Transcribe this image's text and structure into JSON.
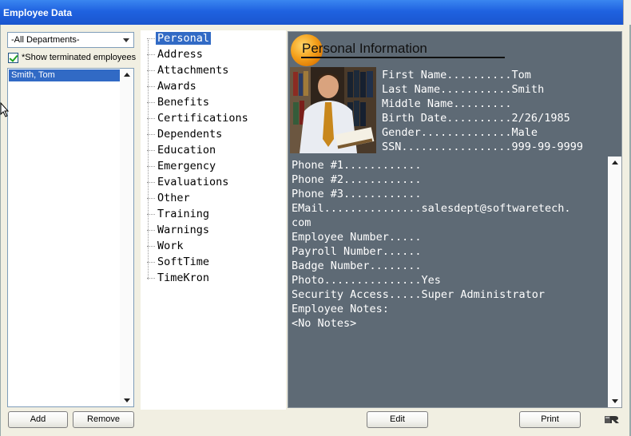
{
  "window": {
    "title": "Employee Data"
  },
  "left": {
    "department_select": "-All Departments-",
    "show_terminated_label": "*Show terminated employees",
    "show_terminated_checked": true,
    "employees": [
      "Smith, Tom"
    ]
  },
  "sections": [
    "Personal",
    "Address",
    "Attachments",
    "Awards",
    "Benefits",
    "Certifications",
    "Dependents",
    "Education",
    "Emergency",
    "Evaluations",
    "Other",
    "Training",
    "Warnings",
    "Work",
    "SoftTime",
    "TimeKron"
  ],
  "selected_section": "Personal",
  "detail": {
    "header": "Personal Information",
    "top_fields": [
      "First Name..........Tom",
      "Last Name...........Smith",
      "Middle Name.........",
      "Birth Date..........2/26/1985",
      "Gender..............Male",
      "SSN.................999-99-9999"
    ],
    "lines": [
      "Phone #1............",
      "Phone #2............",
      "Phone #3............",
      "EMail...............salesdept@softwaretech.",
      "com",
      "Employee Number.....",
      "Payroll Number......",
      "Badge Number........",
      "Photo...............Yes",
      "Security Access.....Super Administrator",
      "Employee Notes:",
      "<No Notes>"
    ]
  },
  "buttons": {
    "add": "Add",
    "remove": "Remove",
    "edit": "Edit",
    "print": "Print"
  },
  "colors": {
    "title_bar": "#1f62e0",
    "selection": "#316ac5",
    "detail_bg": "#5e6a75",
    "window_bg": "#f1efe2"
  }
}
